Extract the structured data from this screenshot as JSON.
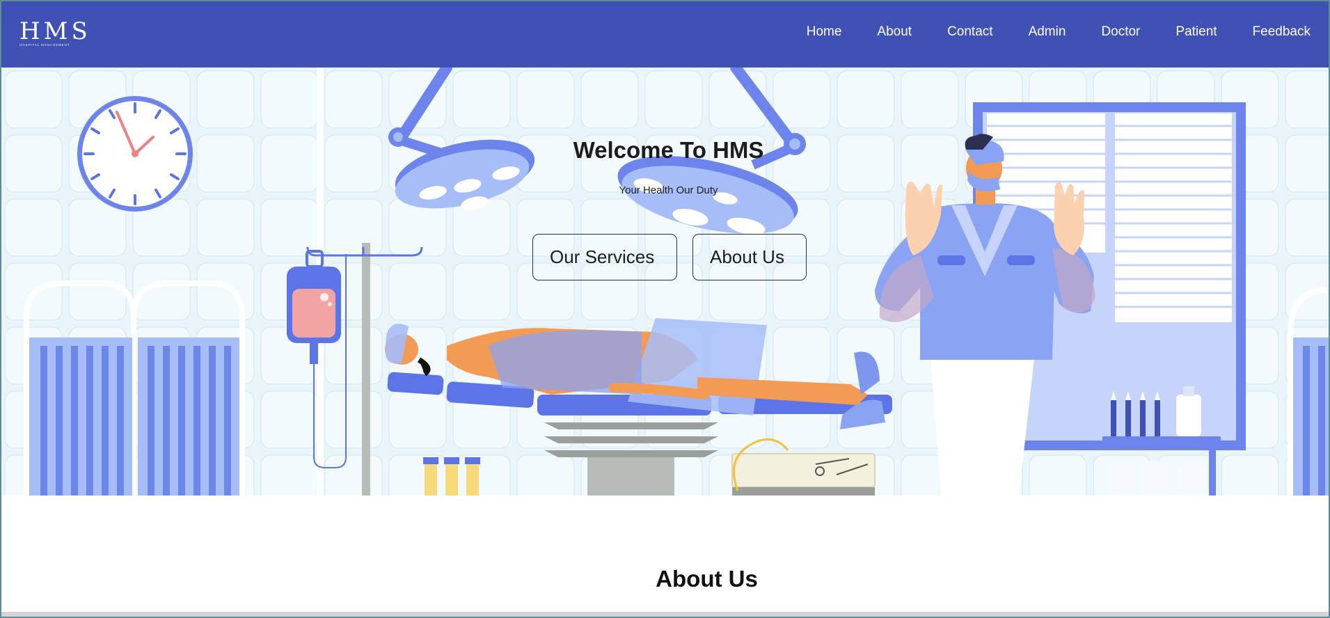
{
  "brand": {
    "logo_text": "HMS",
    "logo_subtext": "HOSPITAL MANAGEMENT"
  },
  "nav": {
    "items": [
      {
        "label": "Home"
      },
      {
        "label": "About"
      },
      {
        "label": "Contact"
      },
      {
        "label": "Admin"
      },
      {
        "label": "Doctor"
      },
      {
        "label": "Patient"
      },
      {
        "label": "Feedback"
      }
    ]
  },
  "hero": {
    "title": "Welcome To HMS",
    "subtitle": "Your Health Our Duty",
    "buttons": {
      "services_label": "Our Services",
      "about_label": "About Us"
    }
  },
  "about": {
    "heading": "About Us"
  },
  "colors": {
    "navbar": "#4051b5",
    "hero_background": "#e9f5fa",
    "illustration_blue": "#8aa3f2",
    "illustration_dark_blue": "#5c74e6",
    "skin_orange": "#f39a55"
  },
  "icons": [
    "hospital-logo-icon",
    "clock-icon",
    "iv-drip-icon",
    "surgical-lamp-icon",
    "doctor-illustration",
    "patient-illustration"
  ]
}
